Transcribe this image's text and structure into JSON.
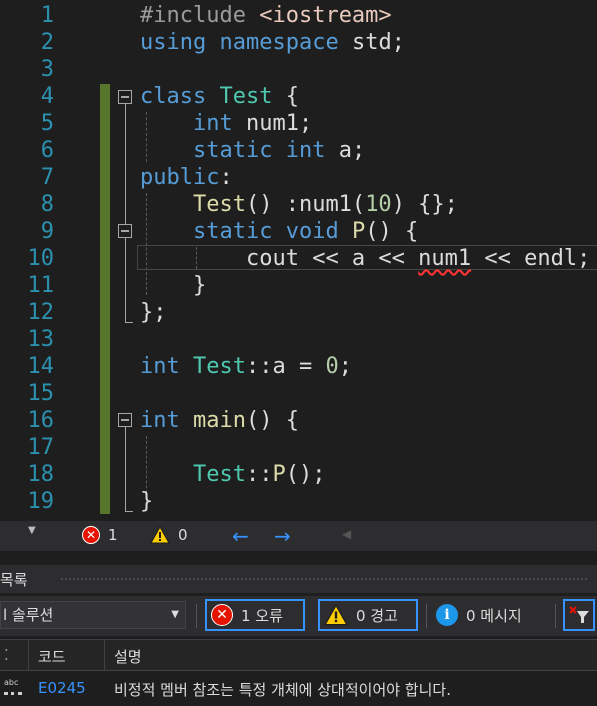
{
  "editor": {
    "line_numbers": [
      "1",
      "2",
      "3",
      "4",
      "5",
      "6",
      "7",
      "8",
      "9",
      "10",
      "11",
      "12",
      "13",
      "14",
      "15",
      "16",
      "17",
      "18",
      "19"
    ],
    "lines": {
      "l1_pp": "#include ",
      "l1_str": "<iostream>",
      "l2_kw1": "using",
      "l2_kw2": "namespace",
      "l2_rest": " std;",
      "l4_kw": "class",
      "l4_typ": "Test",
      "l4_rest": " {",
      "l5_kw": "int",
      "l5_rest": " num1;",
      "l6_kw1": "static",
      "l6_kw2": "int",
      "l6_rest": " a;",
      "l7_kw": "public",
      "l7_rest": ":",
      "l8_fn": "Test",
      "l8_a": "() :num1(",
      "l8_num": "10",
      "l8_b": ") {};",
      "l9_kw1": "static",
      "l9_kw2": "void",
      "l9_fn": "P",
      "l9_rest": "() {",
      "l10_a": "cout << a << ",
      "l10_err": "num1",
      "l10_b": " << endl;",
      "l11": "}",
      "l12": "};",
      "l14_kw": "int",
      "l14_typ": "Test",
      "l14_a": "::a = ",
      "l14_num": "0",
      "l14_b": ";",
      "l16_kw": "int",
      "l16_fn": "main",
      "l16_rest": "() {",
      "l18_typ": "Test",
      "l18_a": "::",
      "l18_fn": "P",
      "l18_b": "();",
      "l19": "}"
    }
  },
  "status_bar": {
    "error_count": "1",
    "warning_count": "0"
  },
  "panel": {
    "title": "목록"
  },
  "toolbar": {
    "scope_value": "l 솔루션",
    "errors_label": "1 오류",
    "warnings_label": "0 경고",
    "messages_label": "0 메시지"
  },
  "list": {
    "col_code": "코드",
    "col_desc": "설명",
    "rows": [
      {
        "code": "E0245",
        "description": "비정적 멤버 참조는 특정 개체에 상대적이어야 합니다."
      }
    ]
  },
  "colors": {
    "error": "#e51400",
    "warning": "#ffcc00",
    "accent": "#3794ff",
    "change_bar": "#57762c"
  }
}
